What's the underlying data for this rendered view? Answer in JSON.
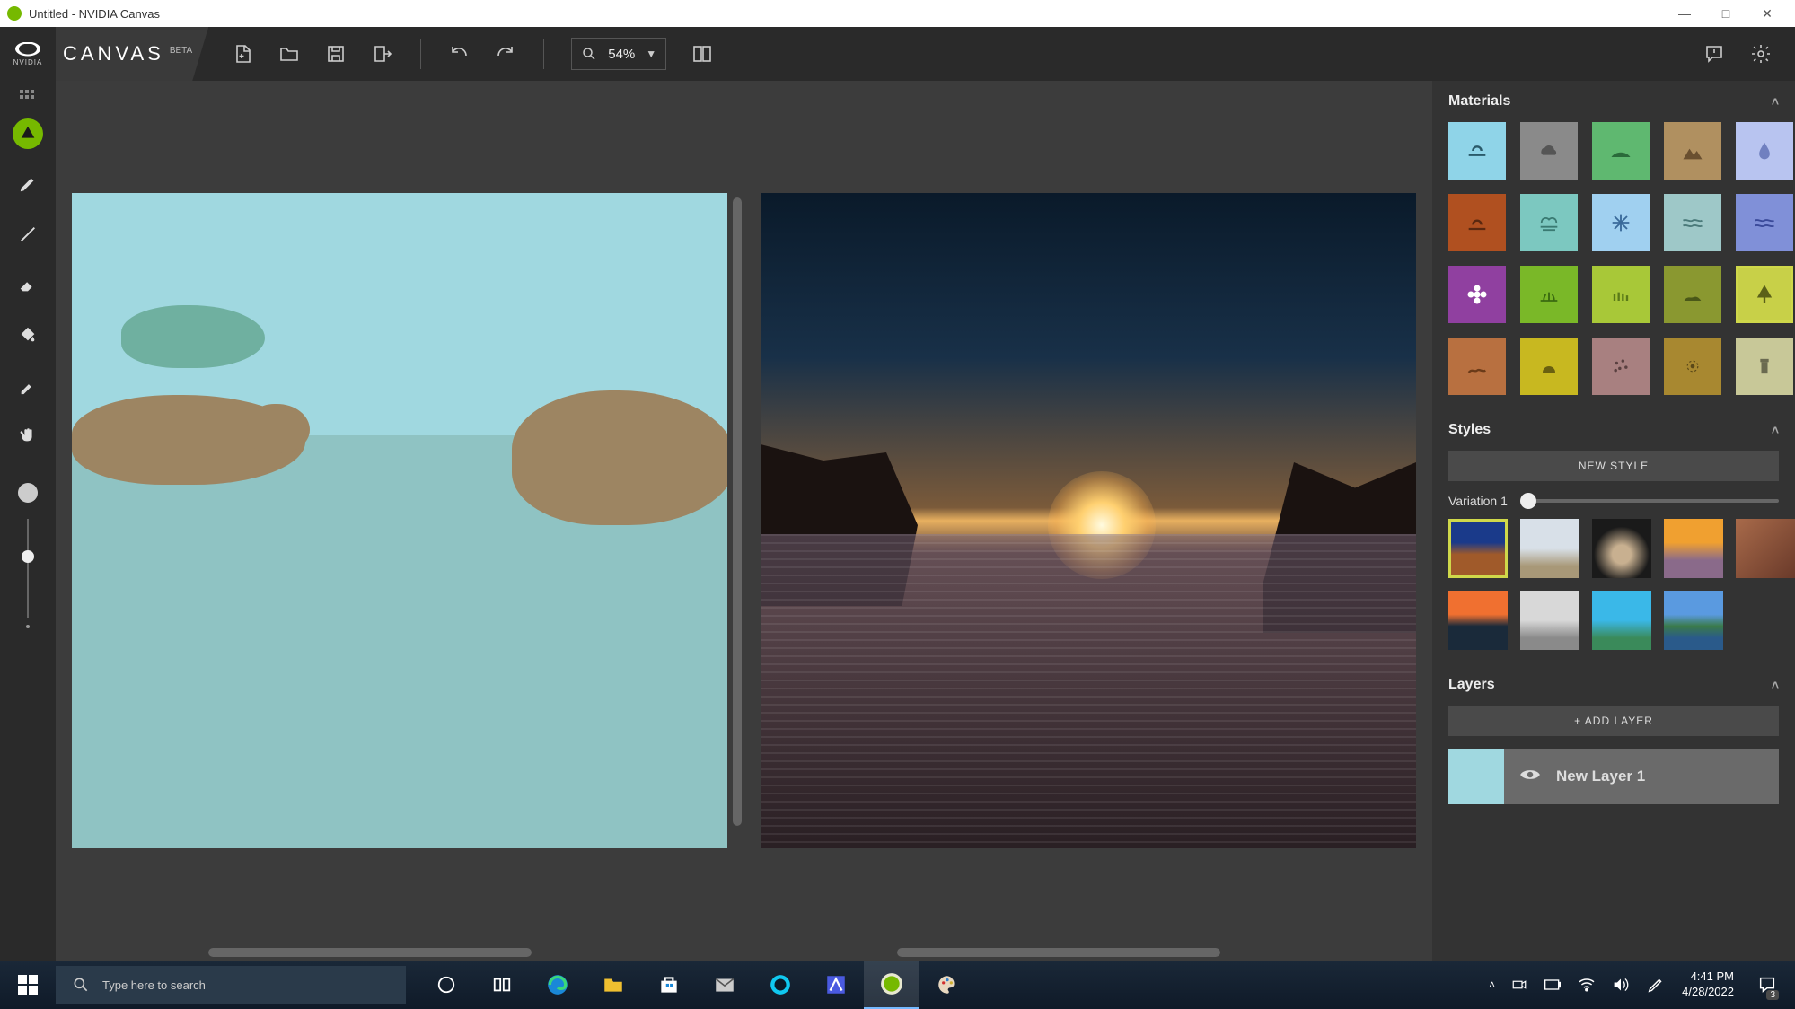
{
  "window": {
    "title": "Untitled - NVIDIA Canvas",
    "minimize": "—",
    "maximize": "□",
    "close": "✕"
  },
  "brand": {
    "nvidia": "NVIDIA",
    "canvas": "CANVAS",
    "beta": "BETA"
  },
  "toolbar": {
    "zoom": "54%"
  },
  "materials": {
    "title": "Materials"
  },
  "styles": {
    "title": "Styles",
    "new_style": "NEW STYLE",
    "variation": "Variation 1"
  },
  "layers": {
    "title": "Layers",
    "add": "+ ADD LAYER",
    "layer1": "New Layer 1"
  },
  "taskbar": {
    "search_placeholder": "Type here to search",
    "time": "4:41 PM",
    "date": "4/28/2022",
    "notif_count": "3"
  }
}
